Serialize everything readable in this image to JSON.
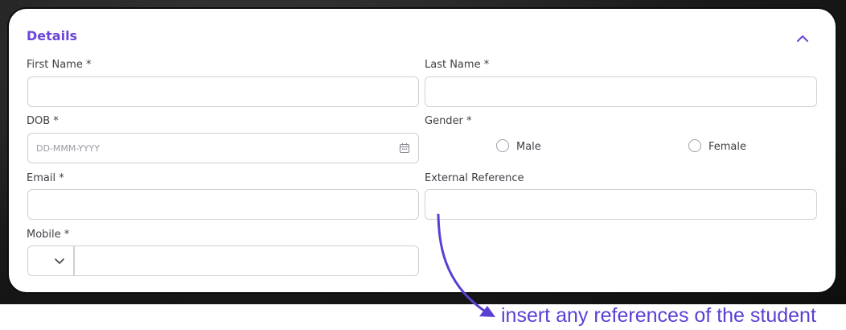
{
  "section": {
    "title": "Details"
  },
  "labels": {
    "first_name": "First Name *",
    "last_name": "Last Name *",
    "dob": "DOB *",
    "gender": "Gender *",
    "email": "Email *",
    "external_reference": "External Reference",
    "mobile": "Mobile *"
  },
  "inputs": {
    "first_name": {
      "value": "",
      "placeholder": ""
    },
    "last_name": {
      "value": "",
      "placeholder": ""
    },
    "dob": {
      "value": "",
      "placeholder": "DD-MMM-YYYY"
    },
    "email": {
      "value": "",
      "placeholder": ""
    },
    "external_reference": {
      "value": "",
      "placeholder": ""
    },
    "mobile": {
      "value": "",
      "placeholder": ""
    }
  },
  "gender_options": [
    "Male",
    "Female"
  ],
  "annotation": {
    "text": "insert any references of the student",
    "color": "#5b3fd4"
  },
  "colors": {
    "accent": "#6a46d8",
    "border": "#cfd0d6"
  }
}
